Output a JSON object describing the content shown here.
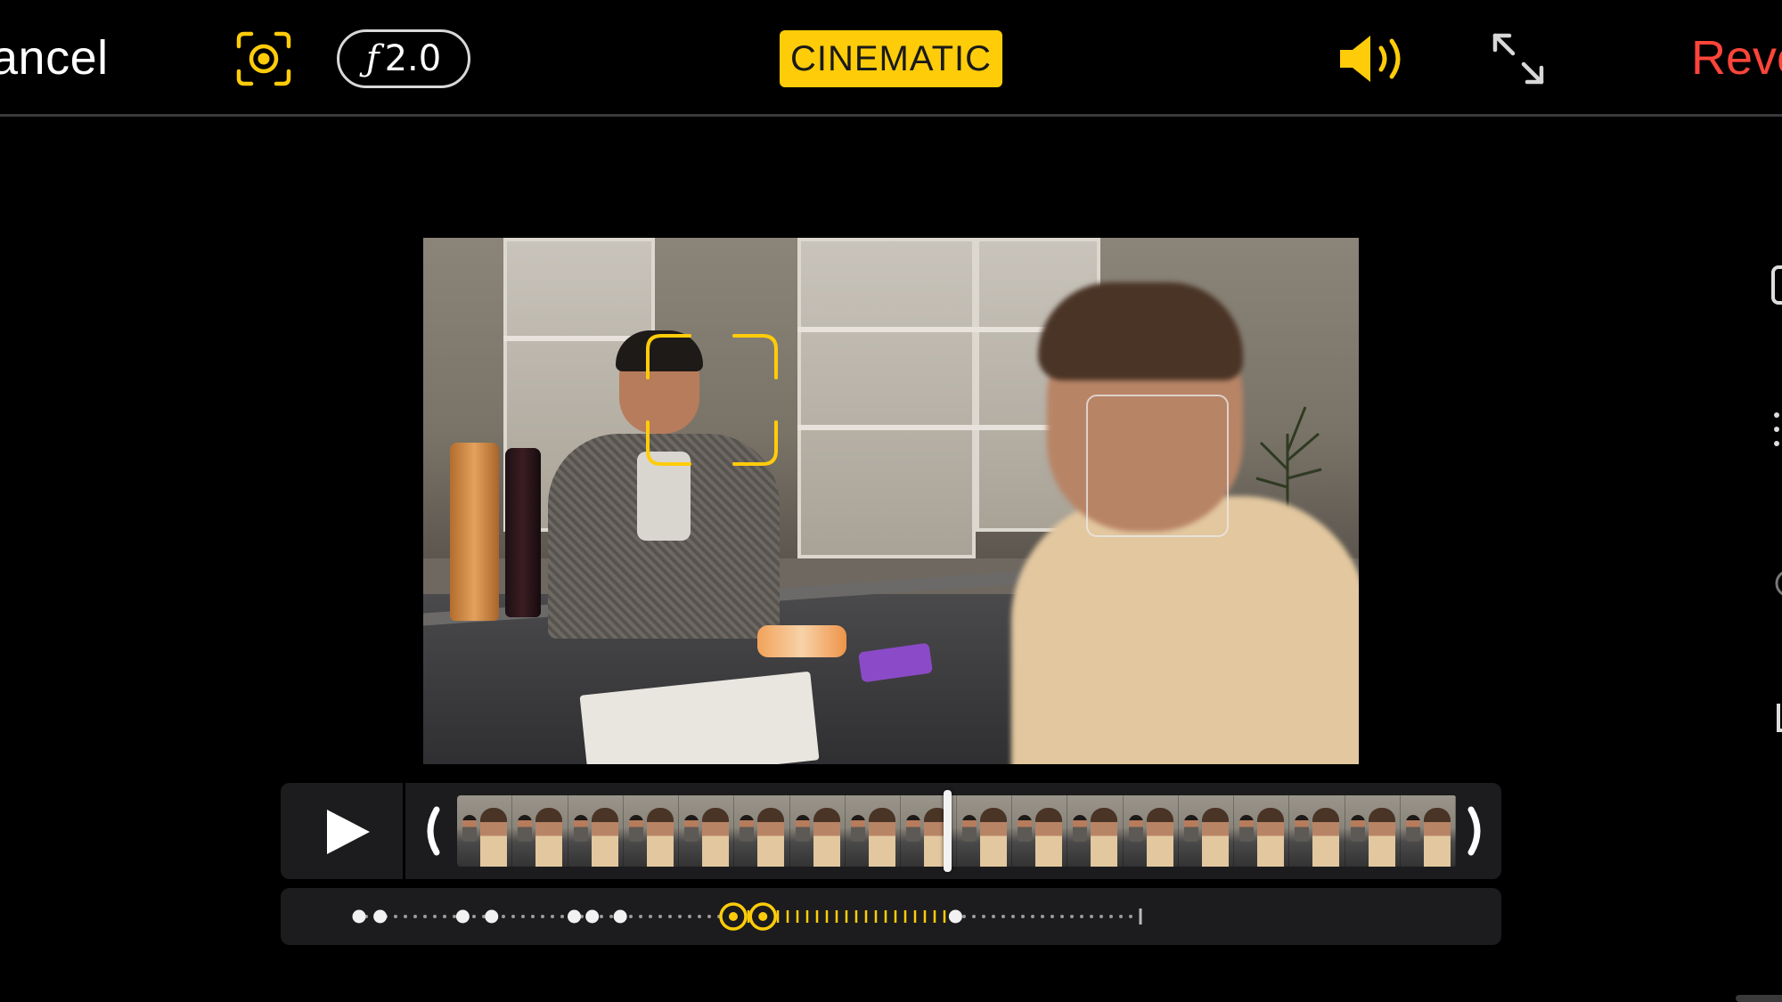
{
  "toolbar": {
    "cancel_label": "ancel",
    "aperture_symbol": "ƒ",
    "aperture_value": "2.0",
    "mode_badge": "CINEMATIC",
    "revert_label": "Reve",
    "icons": [
      "focus-lock-icon",
      "speaker-icon",
      "expand-icon"
    ]
  },
  "colors": {
    "accent_yellow": "#ffcc0a",
    "revert_red": "#ff453a",
    "timeline_bg": "#1c1c1e"
  },
  "preview": {
    "focus_primary": "face-woman",
    "focus_secondary": "face-boy"
  },
  "timeline": {
    "frame_count": 18,
    "playhead_fraction": 0.49
  },
  "focus_track": {
    "start_fraction": 0.0,
    "points": [
      {
        "at": 0.0,
        "kind": "auto"
      },
      {
        "at": 0.027,
        "kind": "auto"
      },
      {
        "at": 0.133,
        "kind": "auto"
      },
      {
        "at": 0.17,
        "kind": "auto"
      },
      {
        "at": 0.276,
        "kind": "auto"
      },
      {
        "at": 0.299,
        "kind": "auto"
      },
      {
        "at": 0.335,
        "kind": "auto"
      },
      {
        "at": 0.48,
        "kind": "manual"
      },
      {
        "at": 0.518,
        "kind": "manual"
      },
      {
        "at": 0.765,
        "kind": "auto"
      }
    ],
    "active_range": [
      0.48,
      0.765
    ]
  }
}
